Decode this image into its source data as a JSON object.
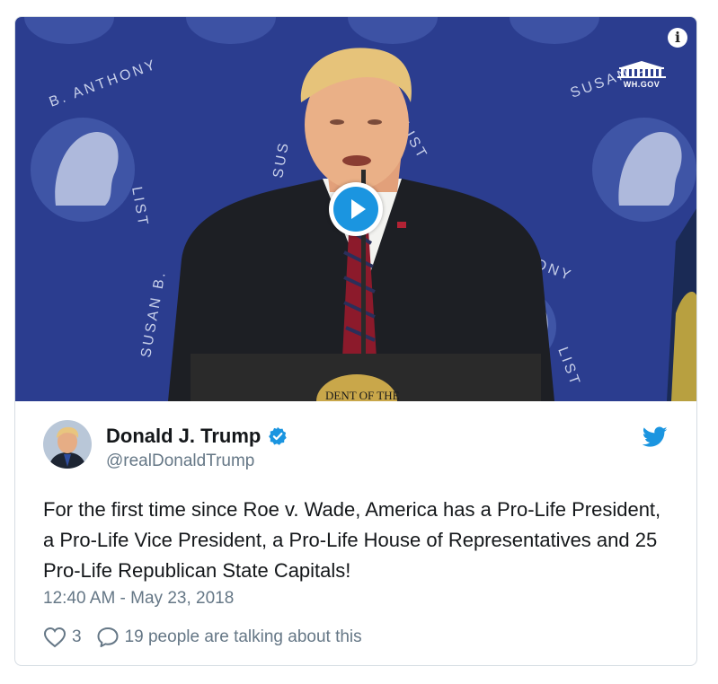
{
  "media": {
    "badge_text": "WH.GOV",
    "info_label": "i",
    "banner_text": "SUSAN B. ANTHONY LIST",
    "podium_text": "DENT OF THE"
  },
  "tweet": {
    "author_name": "Donald J. Trump",
    "handle": "@realDonaldTrump",
    "text": "For the first time since Roe v. Wade, America has a Pro-Life President, a Pro-Life Vice President, a Pro-Life House of Representatives and 25 Pro-Life Republican State Capitals!",
    "timestamp": "12:40 AM - May 23, 2018",
    "likes": "3",
    "talking": "19 people are talking about this"
  },
  "colors": {
    "accent": "#1b95e0",
    "text": "#14171a",
    "muted": "#657786",
    "backdrop": "#2b3d8f"
  },
  "icons": {
    "info": "info-icon",
    "play": "play-icon",
    "verified": "verified-badge-icon",
    "bird": "twitter-bird-icon",
    "like": "heart-icon",
    "reply": "speech-bubble-icon"
  }
}
